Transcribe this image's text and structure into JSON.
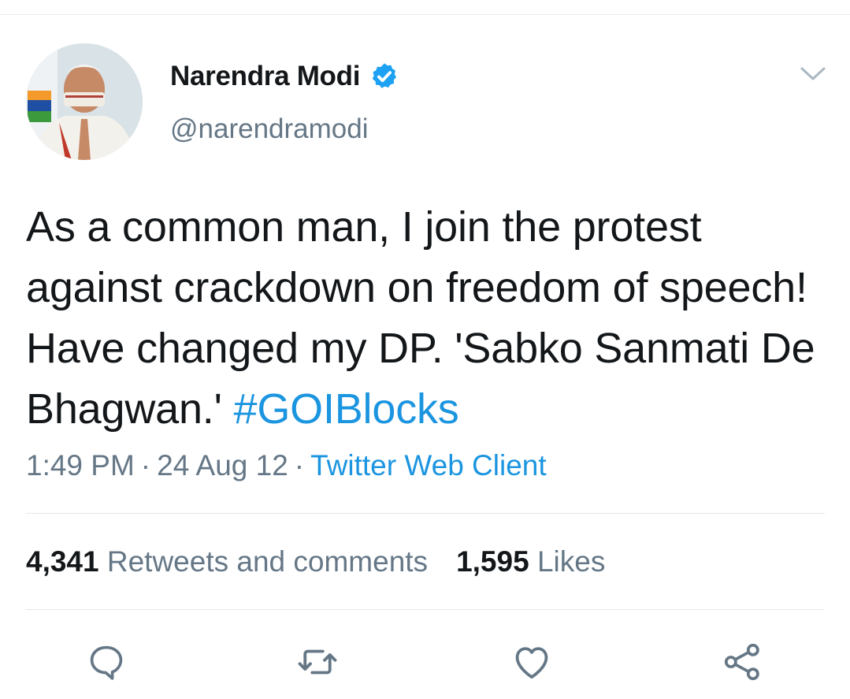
{
  "author": {
    "display_name": "Narendra Modi",
    "handle": "@narendramodi",
    "verified": true
  },
  "tweet": {
    "text": "As a common man, I join the protest against crackdown on freedom of speech! Have changed my DP. 'Sabko Sanmati De Bhagwan.' ",
    "hashtag": "#GOIBlocks"
  },
  "meta": {
    "time": "1:49 PM",
    "separator": "·",
    "date": "24 Aug 12",
    "client": "Twitter Web Client"
  },
  "stats": {
    "retweets_count": "4,341",
    "retweets_label": "Retweets and comments",
    "likes_count": "1,595",
    "likes_label": "Likes"
  },
  "icons": {
    "verified": "verified-badge-icon",
    "caret": "chevron-down-icon",
    "reply": "reply-icon",
    "retweet": "retweet-icon",
    "like": "heart-icon",
    "share": "share-icon"
  },
  "colors": {
    "link": "#1b95e0",
    "muted": "#657786",
    "text": "#14171a",
    "verified": "#1da1f2"
  }
}
